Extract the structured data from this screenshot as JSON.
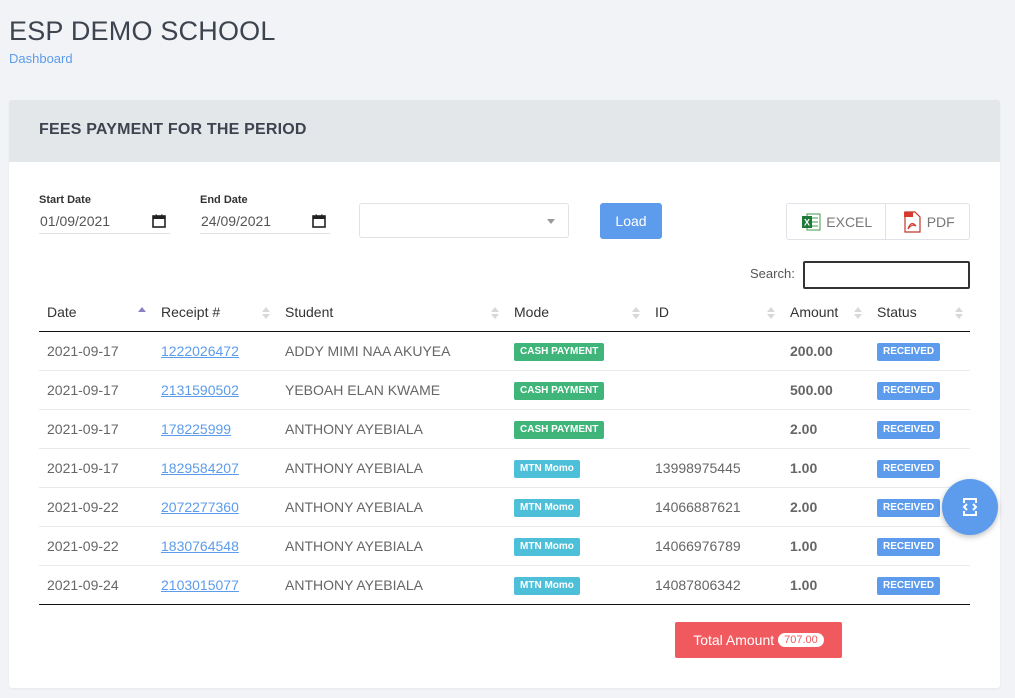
{
  "school_name": "ESP DEMO SCHOOL",
  "breadcrumb": "Dashboard",
  "card_title": "FEES PAYMENT FOR THE PERIOD",
  "filters": {
    "start_label": "Start Date",
    "start_value": "01/09/2021",
    "end_label": "End Date",
    "end_value": "24/09/2021",
    "select_value": "",
    "load_label": "Load"
  },
  "export": {
    "excel_label": "EXCEL",
    "pdf_label": "PDF"
  },
  "search": {
    "label": "Search:",
    "value": ""
  },
  "table": {
    "headers": [
      "Date",
      "Receipt #",
      "Student",
      "Mode",
      "ID",
      "Amount",
      "Status"
    ],
    "rows": [
      {
        "date": "2021-09-17",
        "receipt": "1222026472",
        "student": "ADDY MIMI NAA AKUYEA",
        "mode": "CASH PAYMENT",
        "id": "",
        "amount": "200.00",
        "status": "RECEIVED"
      },
      {
        "date": "2021-09-17",
        "receipt": "2131590502",
        "student": "YEBOAH ELAN KWAME",
        "mode": "CASH PAYMENT",
        "id": "",
        "amount": "500.00",
        "status": "RECEIVED"
      },
      {
        "date": "2021-09-17",
        "receipt": "178225999",
        "student": "ANTHONY AYEBIALA",
        "mode": "CASH PAYMENT",
        "id": "",
        "amount": "2.00",
        "status": "RECEIVED"
      },
      {
        "date": "2021-09-17",
        "receipt": "1829584207",
        "student": "ANTHONY AYEBIALA",
        "mode": "MTN Momo",
        "id": "13998975445",
        "amount": "1.00",
        "status": "RECEIVED"
      },
      {
        "date": "2021-09-22",
        "receipt": "2072277360",
        "student": "ANTHONY AYEBIALA",
        "mode": "MTN Momo",
        "id": "14066887621",
        "amount": "2.00",
        "status": "RECEIVED"
      },
      {
        "date": "2021-09-22",
        "receipt": "1830764548",
        "student": "ANTHONY AYEBIALA",
        "mode": "MTN Momo",
        "id": "14066976789",
        "amount": "1.00",
        "status": "RECEIVED"
      },
      {
        "date": "2021-09-24",
        "receipt": "2103015077",
        "student": "ANTHONY AYEBIALA",
        "mode": "MTN Momo",
        "id": "14087806342",
        "amount": "1.00",
        "status": "RECEIVED"
      }
    ]
  },
  "total": {
    "label": "Total Amount",
    "value": "707.00"
  },
  "colors": {
    "primary": "#5d9cec",
    "cash": "#3fb57a",
    "momo": "#4dbfd9",
    "danger": "#f05a5f"
  },
  "icons": {
    "fab": "code-scan-icon",
    "calendar": "calendar-icon",
    "excel": "excel-icon",
    "pdf": "pdf-icon"
  }
}
